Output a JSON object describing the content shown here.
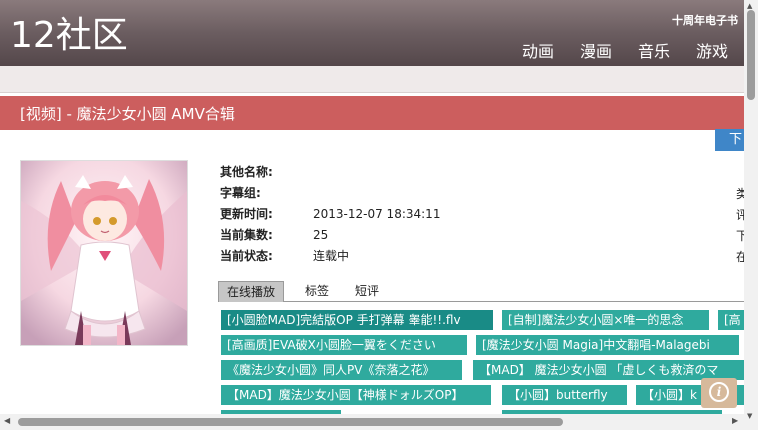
{
  "header": {
    "logo": "12社区",
    "subtitle": "十周年电子书",
    "nav": [
      "动画",
      "漫画",
      "音乐",
      "游戏"
    ]
  },
  "page_title": "[视频] - 魔法少女小圆 AMV合辑",
  "download_label": "下",
  "info": {
    "rows": [
      {
        "label": "其他名称:",
        "value": ""
      },
      {
        "label": "字幕组:",
        "value": ""
      },
      {
        "label": "更新时间:",
        "value": "2013-12-07 18:34:11"
      },
      {
        "label": "当前集数:",
        "value": "25"
      },
      {
        "label": "当前状态:",
        "value": "连载中"
      }
    ],
    "right_column": [
      "类",
      "评",
      "下",
      "在"
    ]
  },
  "tabs": [
    "在线播放",
    "标签",
    "短评"
  ],
  "episodes": [
    "[小圆脸MAD]完結版OP 手打弹幕 睾能!!.flv",
    "[自制]魔法少女小圆×唯一的思念",
    "[高",
    "[高画质]EVA破X小圆脸一翼をください",
    "[魔法少女小圆 Magia]中文翻唱-Malagebi",
    "《魔法少女小圆》同人PV《奈落之花》",
    "【MAD】 魔法少女小圆 「虚しくも救済のマ",
    "【MAD】魔法少女小圆【神様ドォルズOP】",
    "【小圆】butterfly",
    "【小圆】k"
  ],
  "colors": {
    "title_bar": "#cc5e5e",
    "episode_bg": "#2faa9e",
    "header_dark": "#54474a"
  }
}
